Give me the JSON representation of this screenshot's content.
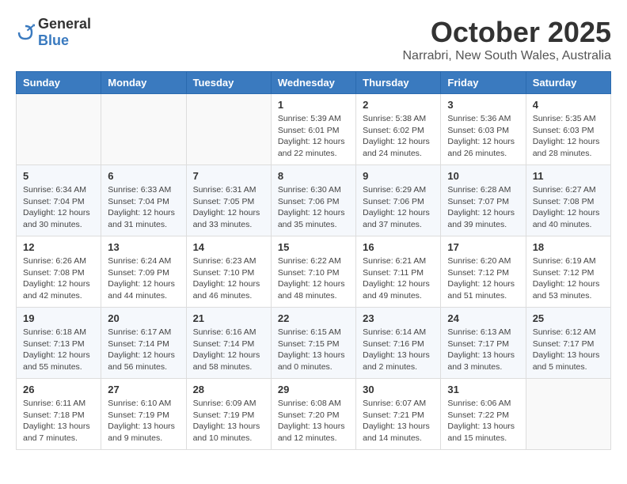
{
  "header": {
    "logo_general": "General",
    "logo_blue": "Blue",
    "month": "October 2025",
    "location": "Narrabri, New South Wales, Australia"
  },
  "days_of_week": [
    "Sunday",
    "Monday",
    "Tuesday",
    "Wednesday",
    "Thursday",
    "Friday",
    "Saturday"
  ],
  "weeks": [
    [
      {
        "day": "",
        "content": ""
      },
      {
        "day": "",
        "content": ""
      },
      {
        "day": "",
        "content": ""
      },
      {
        "day": "1",
        "content": "Sunrise: 5:39 AM\nSunset: 6:01 PM\nDaylight: 12 hours\nand 22 minutes."
      },
      {
        "day": "2",
        "content": "Sunrise: 5:38 AM\nSunset: 6:02 PM\nDaylight: 12 hours\nand 24 minutes."
      },
      {
        "day": "3",
        "content": "Sunrise: 5:36 AM\nSunset: 6:03 PM\nDaylight: 12 hours\nand 26 minutes."
      },
      {
        "day": "4",
        "content": "Sunrise: 5:35 AM\nSunset: 6:03 PM\nDaylight: 12 hours\nand 28 minutes."
      }
    ],
    [
      {
        "day": "5",
        "content": "Sunrise: 6:34 AM\nSunset: 7:04 PM\nDaylight: 12 hours\nand 30 minutes."
      },
      {
        "day": "6",
        "content": "Sunrise: 6:33 AM\nSunset: 7:04 PM\nDaylight: 12 hours\nand 31 minutes."
      },
      {
        "day": "7",
        "content": "Sunrise: 6:31 AM\nSunset: 7:05 PM\nDaylight: 12 hours\nand 33 minutes."
      },
      {
        "day": "8",
        "content": "Sunrise: 6:30 AM\nSunset: 7:06 PM\nDaylight: 12 hours\nand 35 minutes."
      },
      {
        "day": "9",
        "content": "Sunrise: 6:29 AM\nSunset: 7:06 PM\nDaylight: 12 hours\nand 37 minutes."
      },
      {
        "day": "10",
        "content": "Sunrise: 6:28 AM\nSunset: 7:07 PM\nDaylight: 12 hours\nand 39 minutes."
      },
      {
        "day": "11",
        "content": "Sunrise: 6:27 AM\nSunset: 7:08 PM\nDaylight: 12 hours\nand 40 minutes."
      }
    ],
    [
      {
        "day": "12",
        "content": "Sunrise: 6:26 AM\nSunset: 7:08 PM\nDaylight: 12 hours\nand 42 minutes."
      },
      {
        "day": "13",
        "content": "Sunrise: 6:24 AM\nSunset: 7:09 PM\nDaylight: 12 hours\nand 44 minutes."
      },
      {
        "day": "14",
        "content": "Sunrise: 6:23 AM\nSunset: 7:10 PM\nDaylight: 12 hours\nand 46 minutes."
      },
      {
        "day": "15",
        "content": "Sunrise: 6:22 AM\nSunset: 7:10 PM\nDaylight: 12 hours\nand 48 minutes."
      },
      {
        "day": "16",
        "content": "Sunrise: 6:21 AM\nSunset: 7:11 PM\nDaylight: 12 hours\nand 49 minutes."
      },
      {
        "day": "17",
        "content": "Sunrise: 6:20 AM\nSunset: 7:12 PM\nDaylight: 12 hours\nand 51 minutes."
      },
      {
        "day": "18",
        "content": "Sunrise: 6:19 AM\nSunset: 7:12 PM\nDaylight: 12 hours\nand 53 minutes."
      }
    ],
    [
      {
        "day": "19",
        "content": "Sunrise: 6:18 AM\nSunset: 7:13 PM\nDaylight: 12 hours\nand 55 minutes."
      },
      {
        "day": "20",
        "content": "Sunrise: 6:17 AM\nSunset: 7:14 PM\nDaylight: 12 hours\nand 56 minutes."
      },
      {
        "day": "21",
        "content": "Sunrise: 6:16 AM\nSunset: 7:14 PM\nDaylight: 12 hours\nand 58 minutes."
      },
      {
        "day": "22",
        "content": "Sunrise: 6:15 AM\nSunset: 7:15 PM\nDaylight: 13 hours\nand 0 minutes."
      },
      {
        "day": "23",
        "content": "Sunrise: 6:14 AM\nSunset: 7:16 PM\nDaylight: 13 hours\nand 2 minutes."
      },
      {
        "day": "24",
        "content": "Sunrise: 6:13 AM\nSunset: 7:17 PM\nDaylight: 13 hours\nand 3 minutes."
      },
      {
        "day": "25",
        "content": "Sunrise: 6:12 AM\nSunset: 7:17 PM\nDaylight: 13 hours\nand 5 minutes."
      }
    ],
    [
      {
        "day": "26",
        "content": "Sunrise: 6:11 AM\nSunset: 7:18 PM\nDaylight: 13 hours\nand 7 minutes."
      },
      {
        "day": "27",
        "content": "Sunrise: 6:10 AM\nSunset: 7:19 PM\nDaylight: 13 hours\nand 9 minutes."
      },
      {
        "day": "28",
        "content": "Sunrise: 6:09 AM\nSunset: 7:19 PM\nDaylight: 13 hours\nand 10 minutes."
      },
      {
        "day": "29",
        "content": "Sunrise: 6:08 AM\nSunset: 7:20 PM\nDaylight: 13 hours\nand 12 minutes."
      },
      {
        "day": "30",
        "content": "Sunrise: 6:07 AM\nSunset: 7:21 PM\nDaylight: 13 hours\nand 14 minutes."
      },
      {
        "day": "31",
        "content": "Sunrise: 6:06 AM\nSunset: 7:22 PM\nDaylight: 13 hours\nand 15 minutes."
      },
      {
        "day": "",
        "content": ""
      }
    ]
  ]
}
